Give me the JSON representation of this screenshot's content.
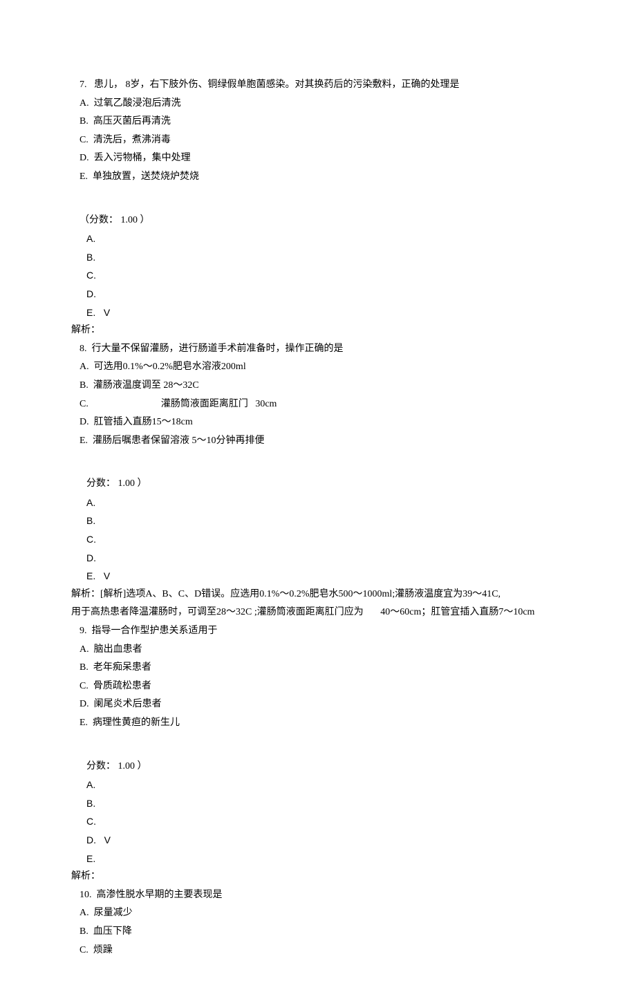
{
  "q7": {
    "num": "7.",
    "stem": "患儿， 8岁，右下肢外伤、铜绿假单胞菌感染。对其换药后的污染敷料，正确的处理是",
    "opts": {
      "A": "A.  过氧乙酸浸泡后清洗",
      "B": "B.  高压灭菌后再清洗",
      "C": "C.  清洗后，煮沸消毒",
      "D": "D.  丢入污物桶，集中处理",
      "E": "E.  单独放置，送焚烧炉焚烧"
    },
    "score": "（分数： 1.00 ）",
    "ans": {
      "A": "A.",
      "B": "B.",
      "C": "C.",
      "D": "D.",
      "E": "E.   V"
    },
    "analysis": "解析："
  },
  "q8": {
    "num": "8.",
    "stem": "行大量不保留灌肠，进行肠道手术前准备时，操作正确的是",
    "opts": {
      "A": "A.  可选用0.1%～0.2%肥皂水溶液200ml",
      "B": "B.  灌肠液温度调至 28～32C",
      "C_pre": "C.",
      "C_post": "灌肠筒液面距离肛门   30cm",
      "D": "D.  肛管插入直肠15～18cm",
      "E": "E.  灌肠后嘱患者保留溶液 5～10分钟再排便"
    },
    "score": "分数： 1.00 ）",
    "ans": {
      "A": "A.",
      "B": "B.",
      "C": "C.",
      "D": "D.",
      "E": "E.   V"
    },
    "analysis": "解析：[解析]选项A、B、C、D错误。应选用0.1%～0.2%肥皂水500～1000ml;灌肠液温度宜为39～41C,",
    "analysis2": "用于高热患者降温灌肠时，可调至28～32C ;灌肠筒液面距离肛门应为       40～60cm；肛管宜插入直肠7～10cm"
  },
  "q9": {
    "num": "9.",
    "stem": "指导一合作型护患关系适用于",
    "opts": {
      "A": "A.  脑出血患者",
      "B": "B.  老年痴呆患者",
      "C": "C.  骨质疏松患者",
      "D": "D.  阑尾炎术后患者",
      "E": "E.  病理性黄疸的新生儿"
    },
    "score": "分数： 1.00 ）",
    "ans": {
      "A": "A.",
      "B": "B.",
      "C": "C.",
      "D": "D.   V",
      "E": "E."
    },
    "analysis": "解析："
  },
  "q10": {
    "num": "10.",
    "stem": "高渗性脱水早期的主要表现是",
    "opts": {
      "A": "A.  尿量减少",
      "B": "B.  血压下降",
      "C": "C.  烦躁"
    }
  }
}
